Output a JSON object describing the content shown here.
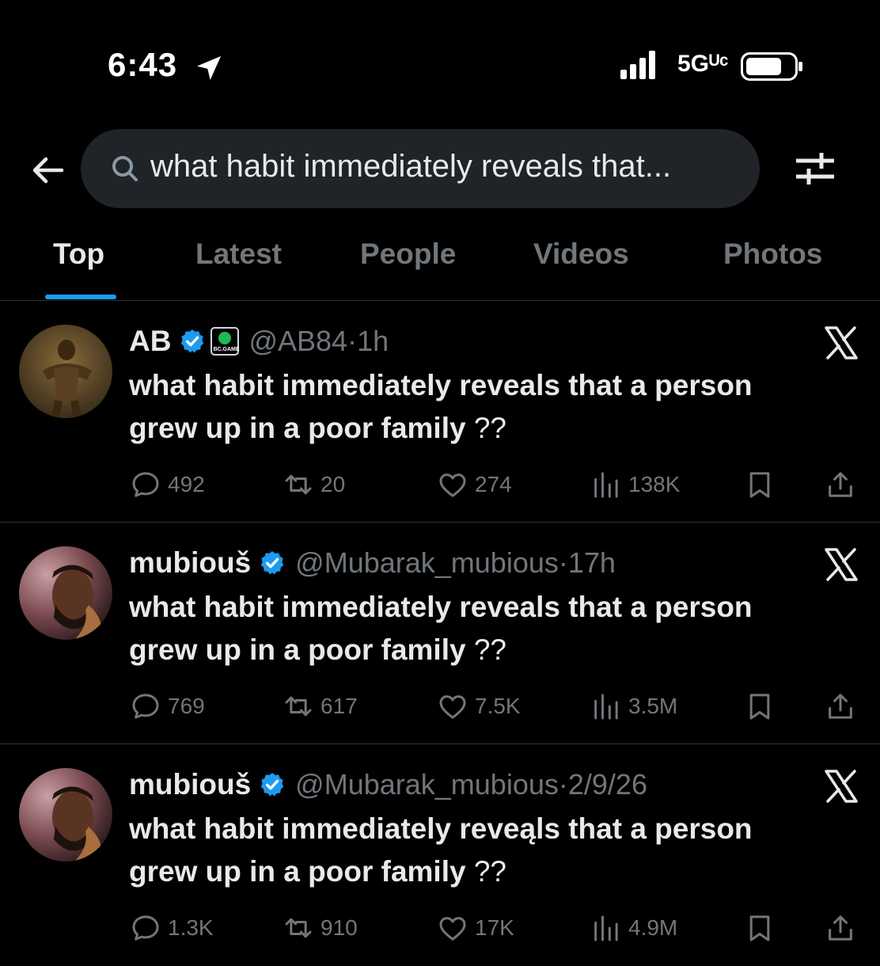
{
  "status_bar": {
    "time": "6:43",
    "network": "5Gᵁᶜ"
  },
  "search": {
    "query": "what habit immediately reveals that..."
  },
  "tabs": [
    {
      "label": "Top",
      "active": true
    },
    {
      "label": "Latest",
      "active": false
    },
    {
      "label": "People",
      "active": false
    },
    {
      "label": "Videos",
      "active": false
    },
    {
      "label": "Photos",
      "active": false
    }
  ],
  "posts": [
    {
      "name": "AB",
      "affiliate_badge": "BC.GAME",
      "handle": "@AB84",
      "time": "1h",
      "text_line1": "what habit immediately reveals that a person",
      "text_line2": "grew up in a poor family",
      "text_suffix": " ??",
      "replies": "492",
      "reposts": "20",
      "likes": "274",
      "views": "138K"
    },
    {
      "name": "mubiouš",
      "handle": "@Mubarak_mubious",
      "time": "17h",
      "text_line1": "what habit immediately reveals that a person",
      "text_line2": "grew up in a poor family",
      "text_suffix": " ??",
      "replies": "769",
      "reposts": "617",
      "likes": "7.5K",
      "views": "3.5M"
    },
    {
      "name": "mubiouš",
      "handle": "@Mubarak_mubious",
      "time": "2/9/26",
      "text_line1": "what habit immediately reveąls that a person",
      "text_line2": "grew up in a poor family",
      "text_suffix": " ??",
      "replies": "1.3K",
      "reposts": "910",
      "likes": "17K",
      "views": "4.9M"
    }
  ],
  "colors": {
    "accent": "#1d9bf0",
    "muted": "#71767b",
    "background": "#000000",
    "search_bg": "#202327"
  }
}
